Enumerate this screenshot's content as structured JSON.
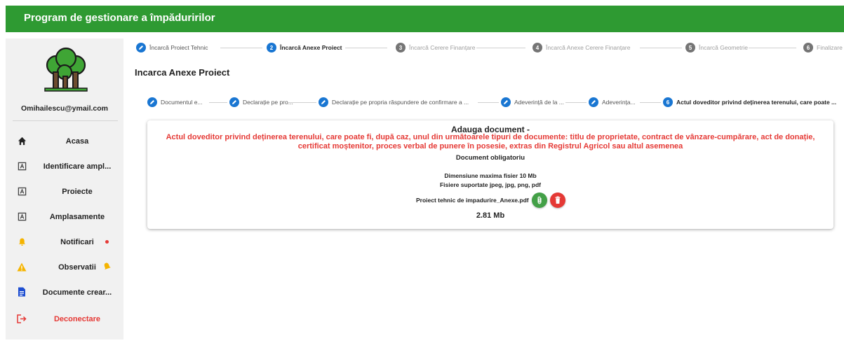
{
  "app": {
    "title": "Program de gestionare a împăduririlor"
  },
  "user": {
    "email": "Omihailescu@ymail.com"
  },
  "sidebar": {
    "items": [
      {
        "label": "Acasa",
        "icon": "home-icon"
      },
      {
        "label": "Identificare ampl...",
        "icon": "map-pin-icon"
      },
      {
        "label": "Proiecte",
        "icon": "map-pin-icon"
      },
      {
        "label": "Amplasamente",
        "icon": "map-pin-icon"
      },
      {
        "label": "Notificari",
        "icon": "bell-icon"
      },
      {
        "label": "Observatii",
        "icon": "warning-icon"
      },
      {
        "label": "Documente crear...",
        "icon": "document-icon"
      },
      {
        "label": "Deconectare",
        "icon": "logout-icon"
      }
    ]
  },
  "main_steps": [
    {
      "number": "1",
      "label": "Încarcă Proiect Tehnic",
      "state": "done"
    },
    {
      "number": "2",
      "label": "Încarcă Anexe Proiect",
      "state": "active"
    },
    {
      "number": "3",
      "label": "Încarcă Cerere Finanțare",
      "state": "pending"
    },
    {
      "number": "4",
      "label": "Încarcă Anexe Cerere Finanțare",
      "state": "pending"
    },
    {
      "number": "5",
      "label": "Încarcă Geometrie",
      "state": "pending"
    },
    {
      "number": "6",
      "label": "Finalizare",
      "state": "pending"
    }
  ],
  "section": {
    "title": "Incarca Anexe Proiect"
  },
  "sub_steps": [
    {
      "number": "1",
      "label": "Documentul e...",
      "state": "done"
    },
    {
      "number": "2",
      "label": "Declarație pe pro...",
      "state": "done"
    },
    {
      "number": "3",
      "label": "Declarație pe propria răspundere de confirmare a ...",
      "state": "done"
    },
    {
      "number": "4",
      "label": "Adeverință de la ...",
      "state": "done"
    },
    {
      "number": "5",
      "label": "Adeverința...",
      "state": "done"
    },
    {
      "number": "6",
      "label": "Actul doveditor privind deținerea terenului, care poate ...",
      "state": "active"
    }
  ],
  "card": {
    "title": "Adauga document -",
    "description": "Actul doveditor privind deținerea terenului, care poate fi, după caz, unul din următoarele tipuri de documente: titlu de proprietate, contract de vânzare-cumpărare, act de donație, certificat moștenitor, proces verbal de punere în posesie, extras din Registrul Agricol sau altul asemenea",
    "required": "Document obligatoriu",
    "max_size": "Dimensiune maxima fisier 10 Mb",
    "types": "Fisiere suportate jpeg, jpg, png, pdf",
    "file_name": "Proiect tehnic de impadurire_Anexe.pdf",
    "file_size": "2.81 Mb"
  },
  "colors": {
    "appbar": "#2e9a32",
    "step_active": "#1976d2",
    "step_pending": "#757575",
    "danger": "#e53935",
    "attach": "#43a047"
  }
}
